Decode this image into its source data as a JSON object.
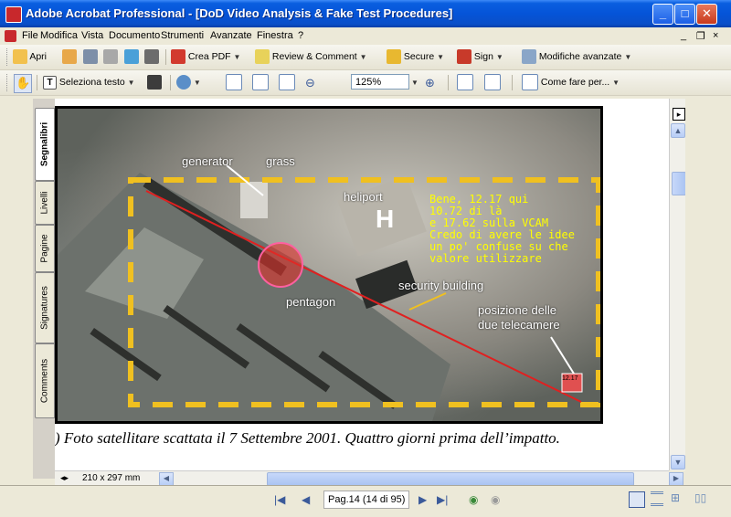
{
  "window": {
    "title": "Adobe Acrobat Professional - [DoD Video Analysis & Fake Test Procedures]",
    "controls": {
      "minimize": "_",
      "maximize": "□",
      "close": "✕"
    }
  },
  "menu": {
    "items": [
      "File",
      "Modifica",
      "Vista",
      "Documento",
      "Strumenti",
      "Avanzate",
      "Finestra",
      "?"
    ],
    "doc_controls": {
      "minimize": "_",
      "restore": "❐",
      "close": "×"
    }
  },
  "toolbar1": {
    "open": "Apri",
    "create_pdf": "Crea PDF",
    "review": "Review & Comment",
    "secure": "Secure",
    "sign": "Sign",
    "advanced_edit": "Modifiche avanzate"
  },
  "toolbar2": {
    "select_text": "Seleziona testo",
    "zoom_value": "125%",
    "howto": "Come fare per..."
  },
  "side_tabs": [
    "Segnalibri",
    "Livelli",
    "Pagine",
    "Signatures",
    "Comments"
  ],
  "document": {
    "photo_labels": {
      "generator": "generator",
      "grass": "grass",
      "heliport": "heliport",
      "security": "security building",
      "pentagon": "pentagon",
      "cameras_1": "posizione delle",
      "cameras_2": "due telecamere",
      "marker": "12.17"
    },
    "note_lines": [
      "Bene, 12.17 qui",
      "10.72 di là",
      "e 17.62 sulla VCAM",
      "Credo di avere le idee",
      "un po' confuse su che",
      "valore utilizzare"
    ],
    "caption": ") Foto satellitare scattata il 7 Settembre 2001. Quattro giorni prima dell’impatto."
  },
  "bottom": {
    "page_size": "210 x 297 mm",
    "page_indicator": "Pag.14  (14 di 95)"
  },
  "colors": {
    "dashed_box": "#f0c020",
    "red_line": "#e02020",
    "circle": "#e0302a",
    "note_text": "#ffff00"
  }
}
